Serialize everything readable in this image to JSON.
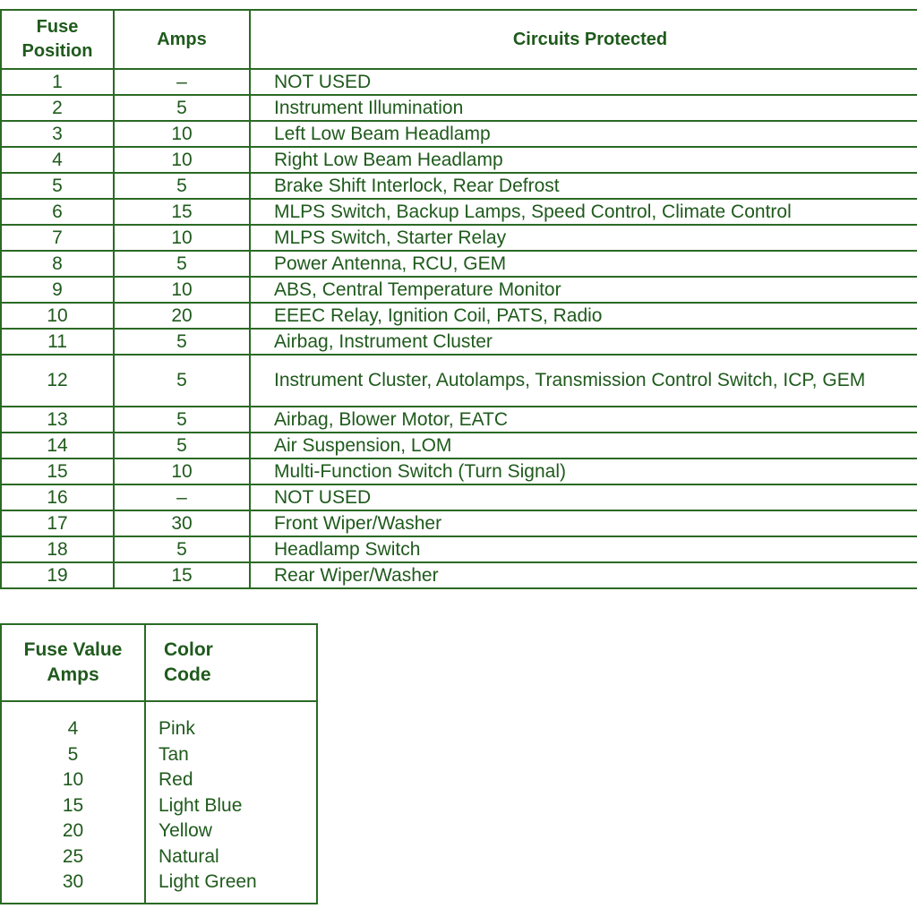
{
  "fuse_table": {
    "headers": {
      "position": [
        "Fuse",
        "Position"
      ],
      "amps": "Amps",
      "circuits": "Circuits Protected"
    },
    "rows": [
      {
        "position": "1",
        "amps": "–",
        "circuits": "NOT USED"
      },
      {
        "position": "2",
        "amps": "5",
        "circuits": "Instrument Illumination"
      },
      {
        "position": "3",
        "amps": "10",
        "circuits": "Left Low Beam Headlamp"
      },
      {
        "position": "4",
        "amps": "10",
        "circuits": "Right Low Beam Headlamp"
      },
      {
        "position": "5",
        "amps": "5",
        "circuits": "Brake Shift Interlock, Rear Defrost"
      },
      {
        "position": "6",
        "amps": "15",
        "circuits": "MLPS Switch, Backup Lamps, Speed Control, Climate Control"
      },
      {
        "position": "7",
        "amps": "10",
        "circuits": "MLPS Switch, Starter Relay"
      },
      {
        "position": "8",
        "amps": "5",
        "circuits": "Power Antenna, RCU, GEM"
      },
      {
        "position": "9",
        "amps": "10",
        "circuits": "ABS, Central Temperature Monitor"
      },
      {
        "position": "10",
        "amps": "20",
        "circuits": "EEEC Relay, Ignition Coil, PATS, Radio"
      },
      {
        "position": "11",
        "amps": "5",
        "circuits": "Airbag, Instrument Cluster"
      },
      {
        "position": "12",
        "amps": "5",
        "circuits": "Instrument Cluster, Autolamps, Transmission Control Switch, ICP, GEM"
      },
      {
        "position": "13",
        "amps": "5",
        "circuits": "Airbag, Blower Motor, EATC"
      },
      {
        "position": "14",
        "amps": "5",
        "circuits": "Air Suspension, LOM"
      },
      {
        "position": "15",
        "amps": "10",
        "circuits": "Multi-Function Switch (Turn Signal)"
      },
      {
        "position": "16",
        "amps": "–",
        "circuits": "NOT USED"
      },
      {
        "position": "17",
        "amps": "30",
        "circuits": "Front Wiper/Washer"
      },
      {
        "position": "18",
        "amps": "5",
        "circuits": "Headlamp Switch"
      },
      {
        "position": "19",
        "amps": "15",
        "circuits": "Rear Wiper/Washer"
      }
    ]
  },
  "color_code_table": {
    "headers": {
      "amps": [
        "Fuse Value",
        "Amps"
      ],
      "color": [
        "Color",
        "Code"
      ]
    },
    "rows": [
      {
        "amps": "4",
        "color": "Pink"
      },
      {
        "amps": "5",
        "color": "Tan"
      },
      {
        "amps": "10",
        "color": "Red"
      },
      {
        "amps": "15",
        "color": "Light Blue"
      },
      {
        "amps": "20",
        "color": "Yellow"
      },
      {
        "amps": "25",
        "color": "Natural"
      },
      {
        "amps": "30",
        "color": "Light Green"
      }
    ]
  },
  "colors": {
    "ink": "#1f5a1c",
    "rule": "#2a6a24",
    "background": "#ffffff"
  }
}
